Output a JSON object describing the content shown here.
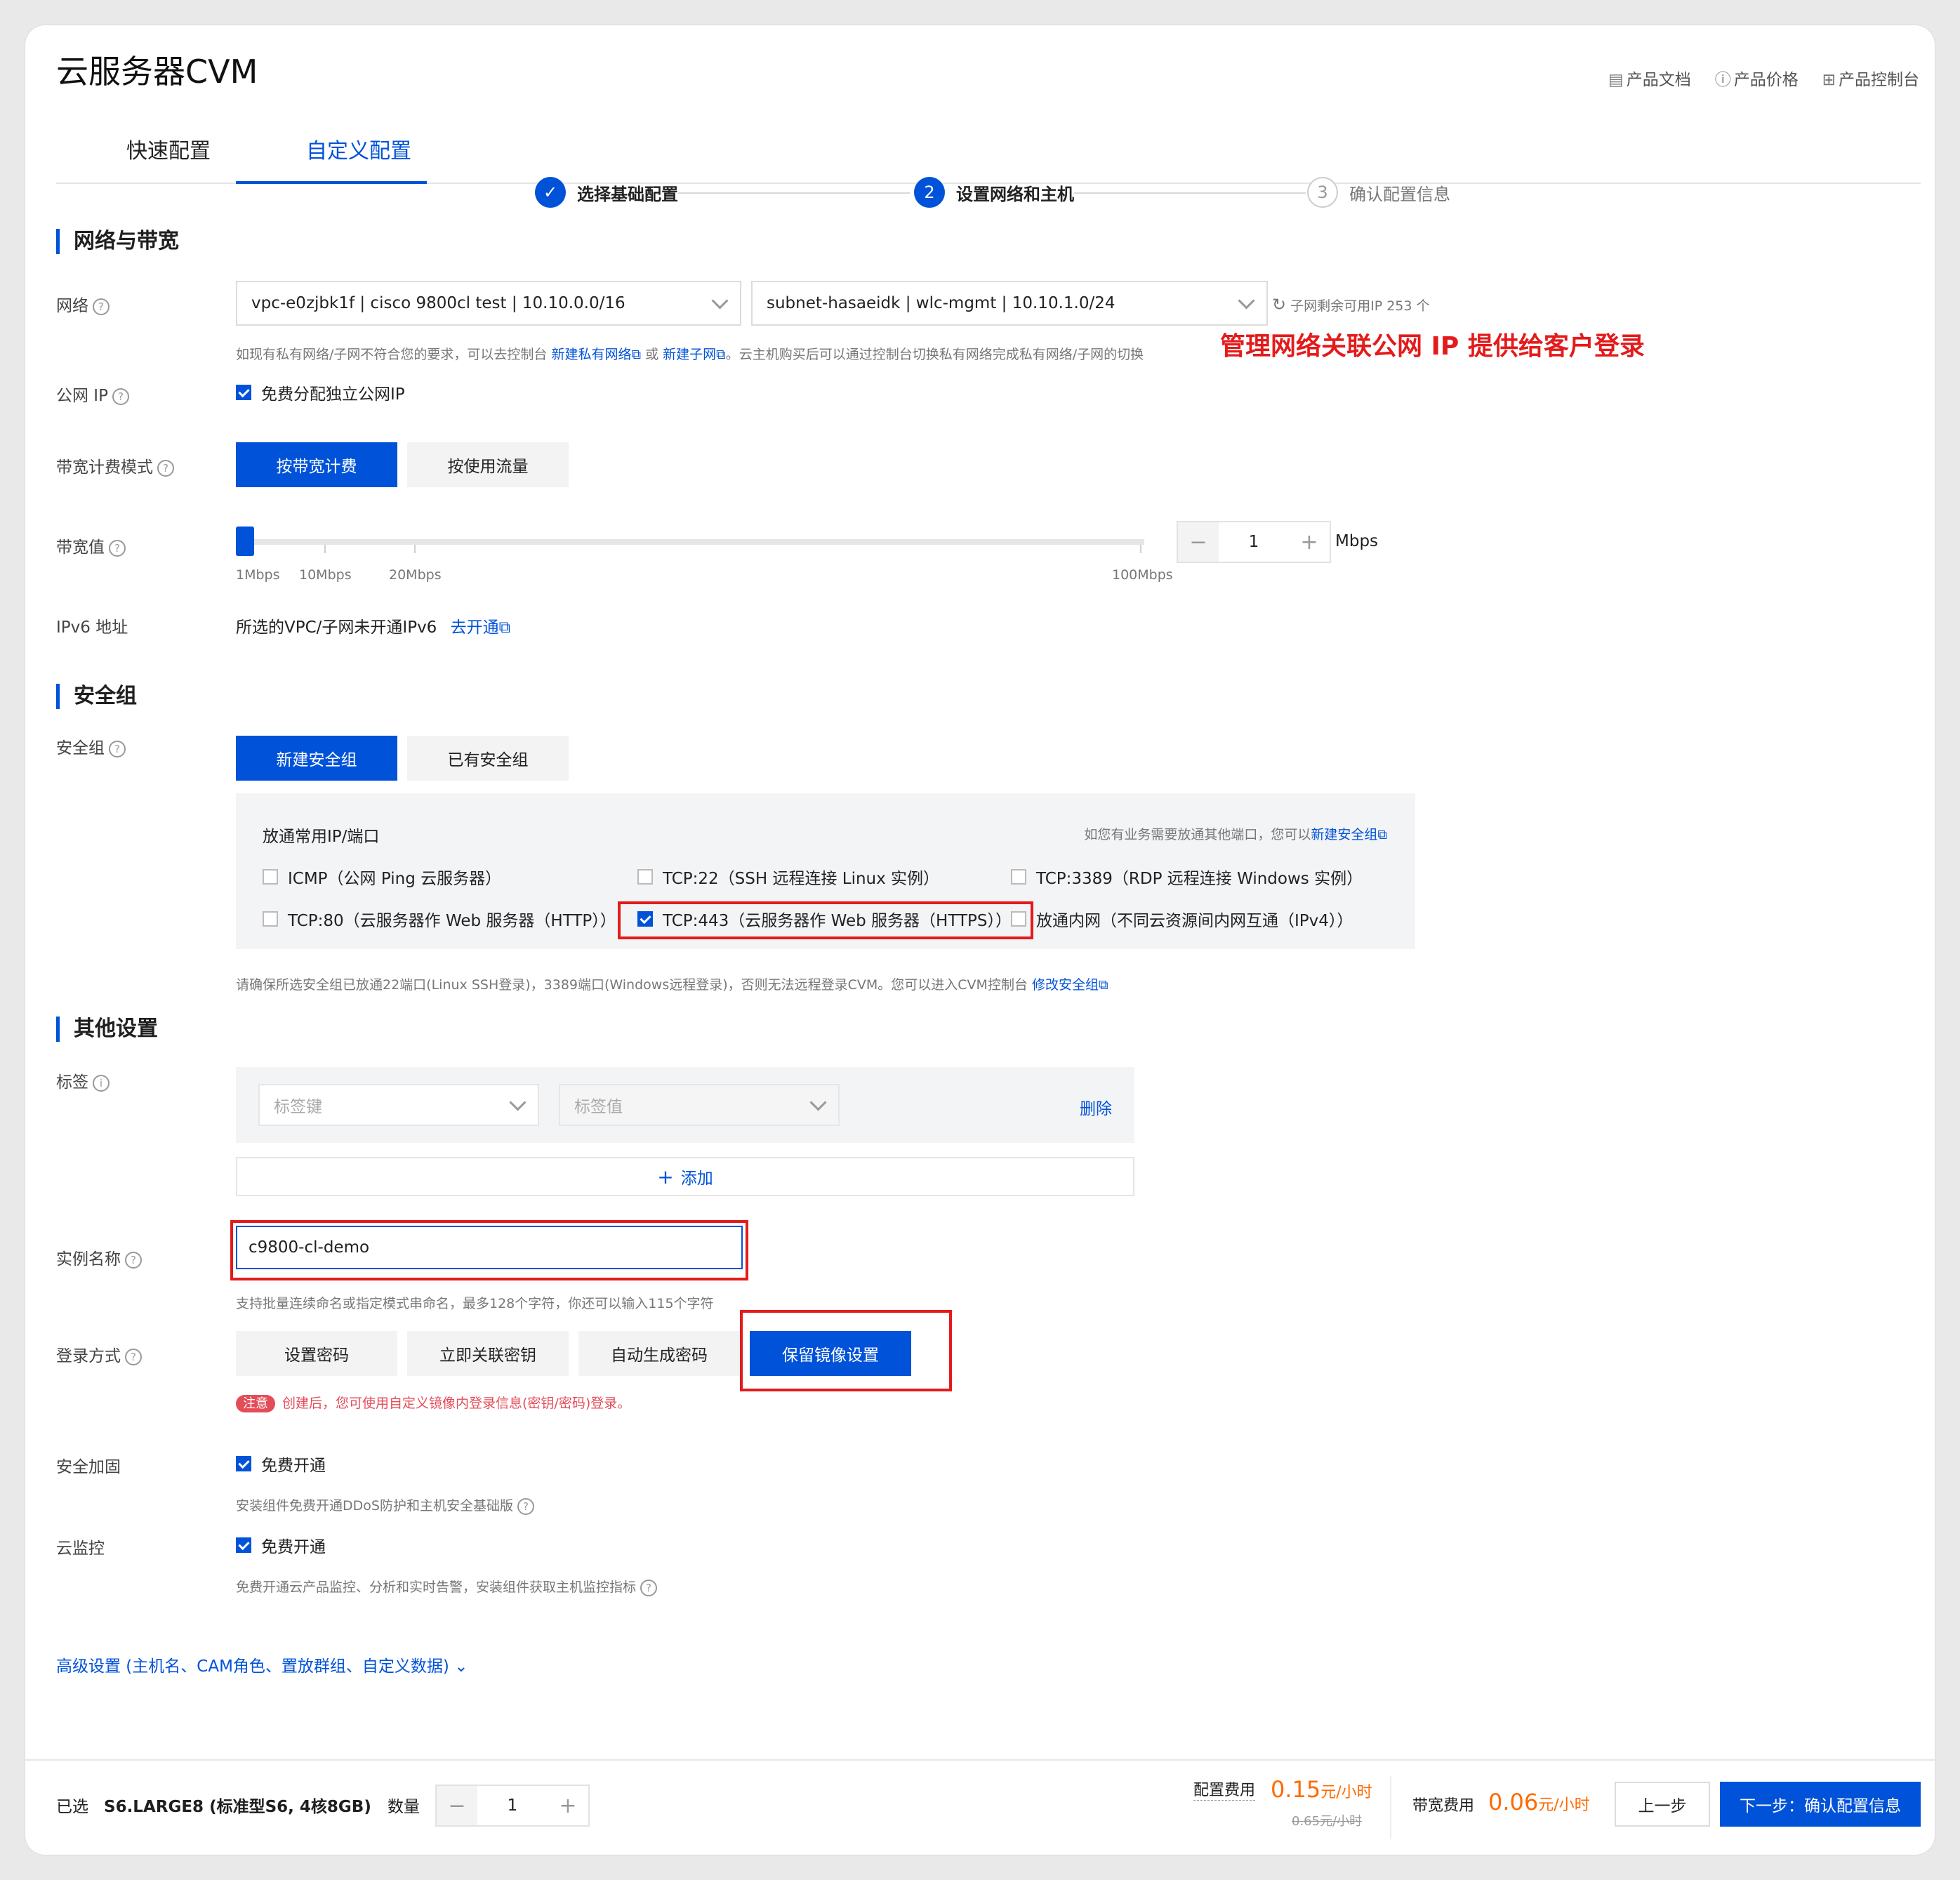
{
  "app": {
    "title": "云服务器CVM"
  },
  "toplinks": [
    {
      "icon": "doc-icon",
      "label": "产品文档"
    },
    {
      "icon": "help-icon",
      "label": "产品价格"
    },
    {
      "icon": "grid-icon",
      "label": "产品控制台"
    }
  ],
  "tabs": [
    {
      "label": "快速配置"
    },
    {
      "label": "自定义配置",
      "active": true
    }
  ],
  "steps": [
    {
      "num": "✓",
      "label": "选择基础配置",
      "state": "done"
    },
    {
      "num": "2",
      "label": "设置网络和主机",
      "state": "current"
    },
    {
      "num": "3",
      "label": "确认配置信息",
      "state": "todo"
    }
  ],
  "network": {
    "section": "网络与带宽",
    "label": "网络",
    "vpc": "vpc-e0zjbk1f | cisco 9800cl test | 10.10.0.0/16",
    "subnet": "subnet-hasaeidk | wlc-mgmt | 10.10.1.0/24",
    "remaining": "子网剩余可用IP 253 个",
    "hint_pre": "如现有私有网络/子网不符合您的要求，可以去控制台",
    "hint_link1": "新建私有网络",
    "hint_or": "或",
    "hint_link2": "新建子网",
    "hint_post": "。云主机购买后可以通过控制台切换私有网络完成私有网络/子网的切换",
    "annotation": "管理网络关联公网 IP 提供给客户登录",
    "public_ip_label": "公网 IP",
    "public_ip_cb": "免费分配独立公网IP",
    "billing_label": "带宽计费模式",
    "billing_opts": [
      "按带宽计费",
      "按使用流量"
    ],
    "bw_label": "带宽值",
    "bw_ticks": [
      "1Mbps",
      "10Mbps",
      "20Mbps",
      "100Mbps"
    ],
    "bw_value": "1",
    "bw_unit": "Mbps",
    "ipv6_label": "IPv6 地址",
    "ipv6_text": "所选的VPC/子网未开通IPv6",
    "ipv6_link": "去开通"
  },
  "security": {
    "section": "安全组",
    "label": "安全组",
    "opts": [
      "新建安全组",
      "已有安全组"
    ],
    "panel_title": "放通常用IP/端口",
    "panel_hint": "如您有业务需要放通其他端口，您可以",
    "panel_link": "新建安全组",
    "rules": [
      {
        "label": "ICMP（公网 Ping 云服务器）",
        "checked": false
      },
      {
        "label": "TCP:22（SSH 远程连接 Linux 实例）",
        "checked": false
      },
      {
        "label": "TCP:3389（RDP 远程连接 Windows 实例）",
        "checked": false
      },
      {
        "label": "TCP:80（云服务器作 Web 服务器（HTTP））",
        "checked": false
      },
      {
        "label": "TCP:443（云服务器作 Web 服务器（HTTPS））",
        "checked": true
      },
      {
        "label": "放通内网（不同云资源间内网互通（IPv4））",
        "checked": false
      }
    ],
    "note": "请确保所选安全组已放通22端口(Linux SSH登录)，3389端口(Windows远程登录)，否则无法远程登录CVM。您可以进入CVM控制台",
    "note_link": "修改安全组"
  },
  "other": {
    "section": "其他设置",
    "tag_label": "标签",
    "tag_key_ph": "标签键",
    "tag_val_ph": "标签值",
    "tag_delete": "删除",
    "tag_add": "添加",
    "name_label": "实例名称",
    "name_value": "c9800-cl-demo",
    "name_hint": "支持批量连续命名或指定模式串命名，最多128个字符，你还可以输入115个字符",
    "login_label": "登录方式",
    "login_opts": [
      "设置密码",
      "立即关联密钥",
      "自动生成密码",
      "保留镜像设置"
    ],
    "note_badge": "注意",
    "note_text": "创建后，您可使用自定义镜像内登录信息(密钥/密码)登录。",
    "harden_label": "安全加固",
    "harden_cb": "免费开通",
    "harden_hint": "安装组件免费开通DDoS防护和主机安全基础版",
    "monitor_label": "云监控",
    "monitor_cb": "免费开通",
    "monitor_hint": "免费开通云产品监控、分析和实时告警，安装组件获取主机监控指标",
    "advanced": "高级设置 (主机名、CAM角色、置放群组、自定义数据)"
  },
  "footer": {
    "selected_label": "已选",
    "selected_value": "S6.LARGE8 (标准型S6, 4核8GB)",
    "qty_label": "数量",
    "qty_value": "1",
    "config_fee_label": "配置费用",
    "config_fee": "0.15",
    "config_fee_unit": "元/小时",
    "config_fee_old": "0.65元/小时",
    "bw_fee_label": "带宽费用",
    "bw_fee": "0.06",
    "bw_fee_unit": "元/小时",
    "prev": "上一步",
    "next": "下一步：确认配置信息"
  },
  "colors": {
    "accent": "#0052d9",
    "price": "#ff6a00",
    "annotation": "#e31b1b"
  }
}
